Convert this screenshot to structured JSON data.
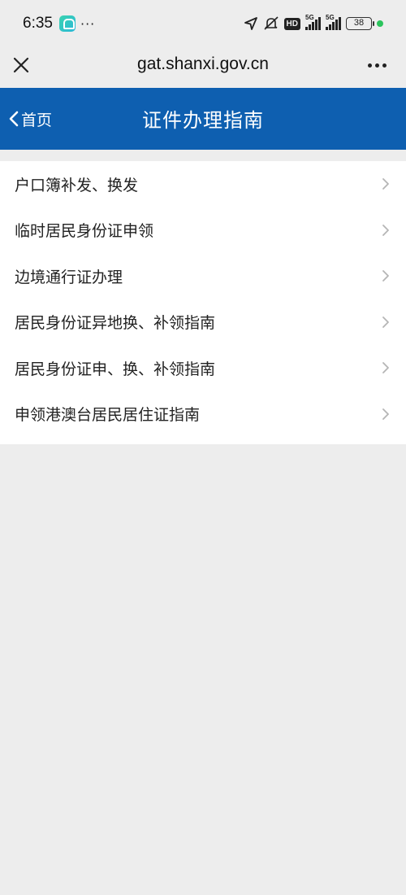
{
  "status_bar": {
    "time": "6:35",
    "more_indicator": "···",
    "hd_label": "HD",
    "signal_1_label": "5G",
    "signal_2_label": "5G",
    "battery_level": "38"
  },
  "browser": {
    "url": "gat.shanxi.gov.cn"
  },
  "header": {
    "back_label": "首页",
    "title": "证件办理指南",
    "background_color": "#0e5fb0"
  },
  "guide_list": {
    "items": [
      {
        "label": "户口簿补发、换发"
      },
      {
        "label": "临时居民身份证申领"
      },
      {
        "label": "边境通行证办理"
      },
      {
        "label": "居民身份证异地换、补领指南"
      },
      {
        "label": "居民身份证申、换、补领指南"
      },
      {
        "label": "申领港澳台居民居住证指南"
      }
    ]
  }
}
